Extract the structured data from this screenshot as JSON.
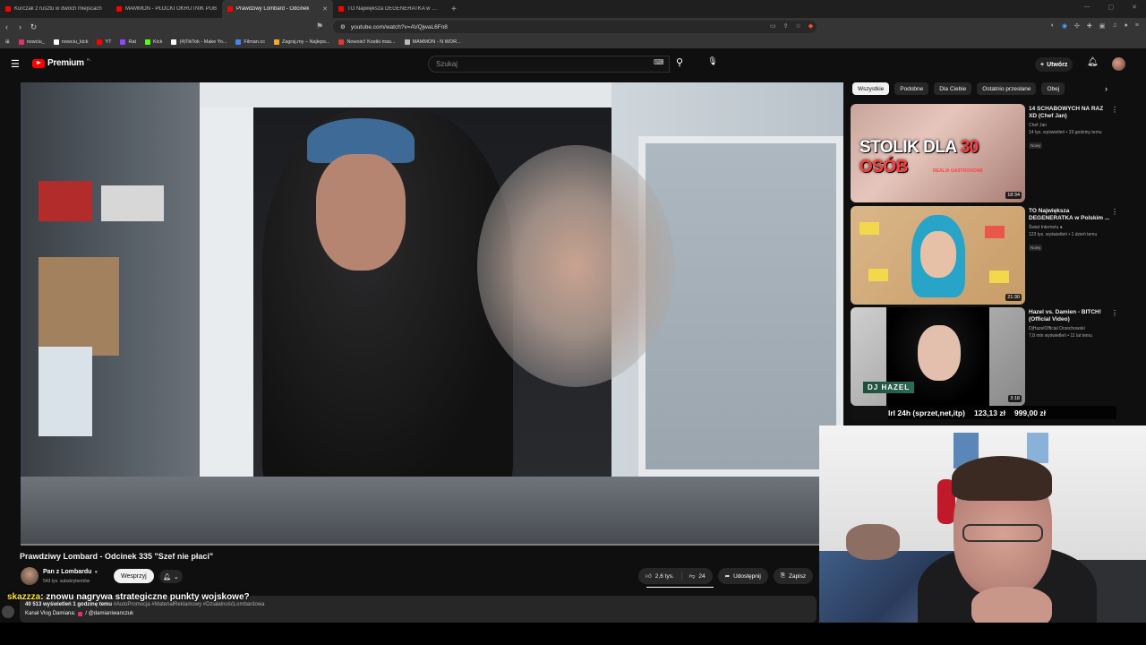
{
  "browser": {
    "tabs": [
      {
        "title": "Kurczak z rusztu w dwóch miejscach",
        "active": false
      },
      {
        "title": "MAMMON - PŁOCKI OKRUTNIK PUB",
        "active": false
      },
      {
        "title": "Prawdziwy Lombard - Odcinek",
        "active": true
      },
      {
        "title": "TO Największa DEGENERATKA w Pol",
        "active": false
      }
    ],
    "url": "youtube.com/watch?v=AVQjwaL6Fn8",
    "bookmarks": [
      {
        "label": "nowciu_",
        "color": "#e1306c"
      },
      {
        "label": "nowciu_kick",
        "color": "#ffffff"
      },
      {
        "label": "YT",
        "color": "#ff0000"
      },
      {
        "label": "Rat",
        "color": "#9146ff"
      },
      {
        "label": "Kick",
        "color": "#53fc18"
      },
      {
        "label": "(4)TikTok - Make Yo...",
        "color": "#ffffff"
      },
      {
        "label": "Filman.cc",
        "color": "#4285f4"
      },
      {
        "label": "Zagraj.my – Najleps...",
        "color": "#f9a825"
      },
      {
        "label": "Nowość! Kostki mas...",
        "color": "#e53935"
      },
      {
        "label": "MAMMON - N WOR...",
        "color": "#bbbbbb"
      }
    ]
  },
  "masthead": {
    "logo_text": "Premium",
    "country": "PL",
    "search_placeholder": "Szukaj",
    "create_label": "Utwórz"
  },
  "video": {
    "title": "Prawdziwy Lombard - Odcinek 335 \"Szef nie płaci\"",
    "channel_name": "Pan z Lombardu",
    "subscribers": "543 tys. subskrybentów",
    "support_label": "Wesprzyj",
    "likes": "2,6 tys.",
    "dislikes": "24",
    "share_label": "Udostępnij",
    "save_label": "Zapisz",
    "views_line": "40 513 wyświetleń  1 godzinę temu",
    "hashtags": "#AutoPromocja #MateriałReklamowy #DziałalnośćLombardowa",
    "desc_line2_prefix": "Kanał Vlog Damiana:",
    "desc_line2_link": "/ @damianiwanczuk"
  },
  "chat": {
    "user": "skazzza",
    "message": ": znowu nagrywa strategiczne punkty wojskowe?"
  },
  "sidebar": {
    "chips": [
      {
        "label": "Wszystkie",
        "active": true
      },
      {
        "label": "Podobne",
        "active": false
      },
      {
        "label": "Dla Ciebie",
        "active": false
      },
      {
        "label": "Ostatnio przesłane",
        "active": false
      },
      {
        "label": "Obej",
        "active": false
      }
    ],
    "recommendations": [
      {
        "title": "14 SCHABOWYCH NA RAZ XD (Chef Jan)",
        "channel": "Chef Jan",
        "stats": "14 tys. wyświetleń • 23 godziny temu",
        "badge": "Nowy",
        "duration": "18:34",
        "thumb_text_white": "STOLIK DLA ",
        "thumb_text_red": "30 OSÓB",
        "thumb_subtext": "REALIA GASTRONOMII"
      },
      {
        "title": "TO Największa DEGENERATKA w Polskim ...",
        "channel": "Świat Internetu",
        "stats": "123 tys. wyświetleń • 1 dzień temu",
        "badge": "Nowy",
        "duration": "21:30"
      },
      {
        "title": "Hazel vs. Damien - BITCH! (Official Video)",
        "channel": "DjHazelOfficial Orzechowski",
        "stats": "7,8 mln wyświetleń • 11 lat temu",
        "badge": "",
        "duration": "3:18",
        "thumb_label": "DJ HAZEL"
      }
    ]
  },
  "ticker": {
    "items": [
      "lrl 24h (sprzet,net,itp)",
      "123,13 zł",
      "999,00 zł"
    ]
  }
}
